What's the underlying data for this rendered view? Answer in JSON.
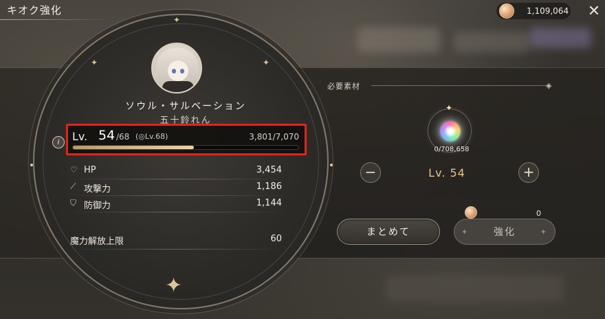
{
  "header": {
    "title": "キオク強化",
    "currency_value": "1,109,064"
  },
  "character": {
    "name": "ソウル・サルベーション",
    "subtitle": "五十鈴れん"
  },
  "level": {
    "prefix": "Lv.",
    "current": "54",
    "max": "/68",
    "soul_cap": "(◎Lv.68)",
    "exp": "3,801/7,070",
    "exp_fraction": 0.538
  },
  "stats": [
    {
      "icon": "heart-icon",
      "glyph": "♡",
      "label": "HP",
      "value": "3,454"
    },
    {
      "icon": "sword-icon",
      "glyph": "⟋",
      "label": "攻撃力",
      "value": "1,186"
    },
    {
      "icon": "shield-icon",
      "glyph": "⛉",
      "label": "防御力",
      "value": "1,144"
    }
  ],
  "magic_limit": {
    "label": "魔力解放上限",
    "value": "60"
  },
  "materials": {
    "section_label": "必要素材",
    "count": "0/708,658",
    "target_level": "Lv. 54",
    "cost": "0"
  },
  "buttons": {
    "bulk": "まとめて",
    "enhance": "強化"
  },
  "colors": {
    "highlight_border": "#e2241b",
    "level_gold": "#e6c38e"
  }
}
